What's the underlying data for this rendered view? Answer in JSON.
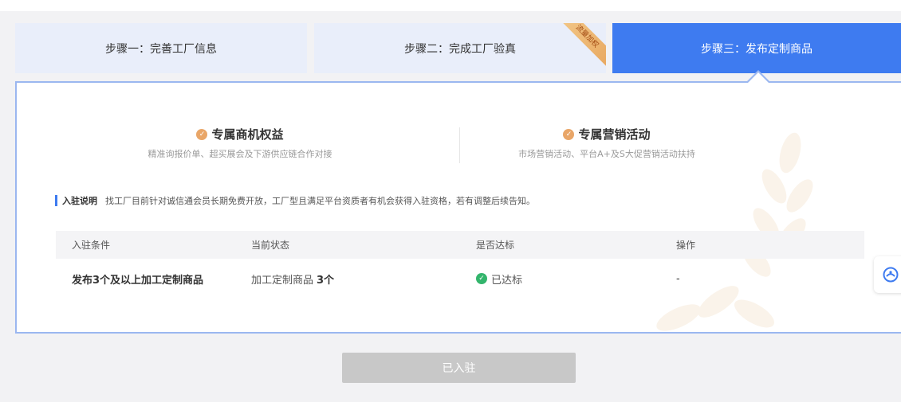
{
  "steps": [
    {
      "label": "步骤一：完善工厂信息"
    },
    {
      "label": "步骤二：完成工厂验真",
      "ribbon": "流量加权"
    },
    {
      "label": "步骤三：发布定制商品",
      "active": true
    }
  ],
  "benefits": [
    {
      "title": "专属商机权益",
      "subtitle": "精准询报价单、超买展会及下游供应链合作对接"
    },
    {
      "title": "专属营销活动",
      "subtitle": "市场营销活动、平台A+及S大促营销活动扶持"
    }
  ],
  "note": {
    "label": "入驻说明",
    "text": "找工厂目前针对诚信通会员长期免费开放，工厂型且满足平台资质者有机会获得入驻资格，若有调整后续告知。"
  },
  "table": {
    "headers": [
      "入驻条件",
      "当前状态",
      "是否达标",
      "操作"
    ],
    "row": {
      "condition": "发布3个及以上加工定制商品",
      "status_prefix": "加工定制商品",
      "status_count": "3个",
      "result": "已达标",
      "action": "-"
    }
  },
  "button": {
    "label": "已入驻"
  },
  "colors": {
    "accent": "#3e7bf0",
    "step_inactive": "#e9eefa",
    "success": "#33b56c",
    "benefit_check": "#e9a668",
    "disabled_button": "#c8c8c8"
  },
  "icons": {
    "widget": "assistant-icon",
    "decoration": "wheat-icon"
  }
}
